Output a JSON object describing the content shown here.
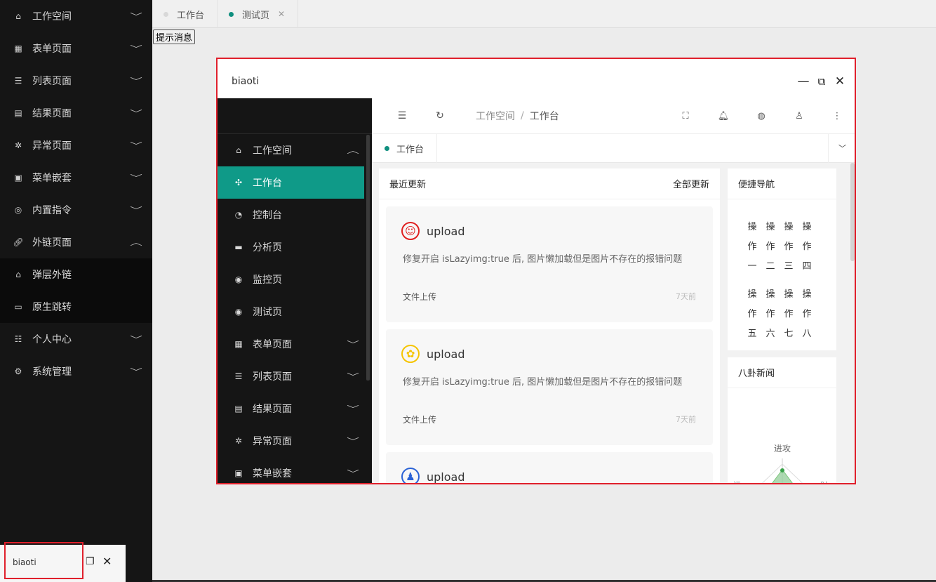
{
  "sidebar": {
    "items": [
      {
        "icon": "home-icon",
        "label": "工作空间",
        "expanded": false
      },
      {
        "icon": "table-icon",
        "label": "表单页面",
        "expanded": false
      },
      {
        "icon": "list-icon",
        "label": "列表页面",
        "expanded": false
      },
      {
        "icon": "result-icon",
        "label": "结果页面",
        "expanded": false
      },
      {
        "icon": "bug-icon",
        "label": "异常页面",
        "expanded": false
      },
      {
        "icon": "grid-icon",
        "label": "菜单嵌套",
        "expanded": false
      },
      {
        "icon": "command-icon",
        "label": "内置指令",
        "expanded": false
      },
      {
        "icon": "link-icon",
        "label": "外链页面",
        "expanded": true
      }
    ],
    "subitems": [
      {
        "icon": "home-icon",
        "label": "弹层外链"
      },
      {
        "icon": "window-icon",
        "label": "原生跳转"
      }
    ],
    "bottom": [
      {
        "icon": "sliders-icon",
        "label": "个人中心"
      },
      {
        "icon": "gear-icon",
        "label": "系统管理"
      }
    ]
  },
  "tabs": [
    {
      "label": "工作台",
      "active": false
    },
    {
      "label": "测试页",
      "active": true
    }
  ],
  "message_button": "提示消息",
  "modal": {
    "title": "biaoti",
    "inner": {
      "menu": {
        "group": "工作空间",
        "children": [
          {
            "icon": "workbench-icon",
            "label": "工作台",
            "active": true
          },
          {
            "icon": "console-icon",
            "label": "控制台",
            "active": false
          },
          {
            "icon": "analysis-icon",
            "label": "分析页",
            "active": false
          },
          {
            "icon": "monitor-icon",
            "label": "监控页",
            "active": false
          },
          {
            "icon": "test-icon",
            "label": "测试页",
            "active": false
          }
        ],
        "others": [
          "表单页面",
          "列表页面",
          "结果页面",
          "异常页面",
          "菜单嵌套"
        ]
      },
      "breadcrumb": [
        "工作空间",
        "工作台"
      ],
      "tab": "工作台",
      "recent": {
        "title": "最近更新",
        "more": "全部更新",
        "posts": [
          {
            "icon": "smile-icon",
            "icon_color": "#e02020",
            "title": "upload",
            "desc": "修复开启 isLazyimg:true 后, 图片懒加载但是图片不存在的报错问题",
            "category": "文件上传",
            "time": "7天前"
          },
          {
            "icon": "palette-icon",
            "icon_color": "#f5c400",
            "title": "upload",
            "desc": "修复开启 isLazyimg:true 后, 图片懒加载但是图片不存在的报错问题",
            "category": "文件上传",
            "time": "7天前"
          },
          {
            "icon": "user-icon",
            "icon_color": "#2a62d6",
            "title": "upload"
          }
        ]
      },
      "quicknav": {
        "title": "便捷导航",
        "cells": [
          "操",
          "操",
          "操",
          "操",
          "作",
          "作",
          "作",
          "作",
          "一",
          "二",
          "三",
          "四",
          "操",
          "操",
          "操",
          "操",
          "作",
          "作",
          "作",
          "作",
          "五",
          "六",
          "七",
          "八"
        ]
      },
      "gossip": {
        "title": "八卦新闻",
        "radar_label": "进攻",
        "radar_left": "污",
        "radar_right": "财"
      }
    }
  },
  "minimized": {
    "title": "biaoti"
  }
}
